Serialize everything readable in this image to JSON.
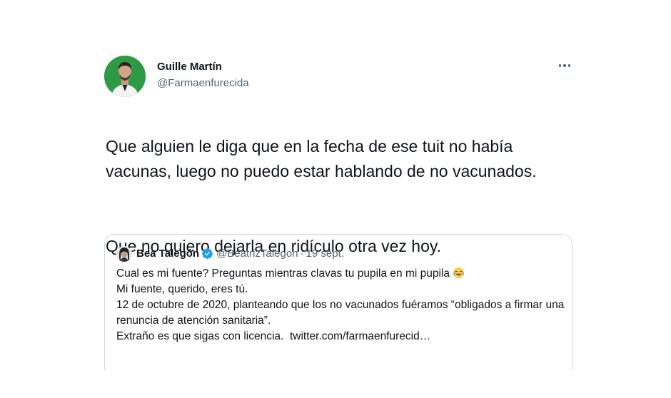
{
  "tweet": {
    "author_name": "Guille Martín",
    "author_handle": "@Farmaenfurecida",
    "paragraphs": [
      "Que alguien le diga que en la fecha de ese tuit no había vacunas, luego no puedo estar hablando de no vacunados.",
      "Que no quiero dejarla en ridículo otra vez hoy."
    ]
  },
  "quoted_tweet": {
    "author_name": "Bea Talegón",
    "author_handle": "@BeatrizTalegon",
    "separator": "·",
    "date": "19 sept.",
    "lines": [
      "Cual es mi fuente? Preguntas mientras clavas tu pupila en mi pupila",
      "Mi fuente, querido, eres tú.",
      "12 de octubre de 2020, planteando que los no vacunados fuéramos “obligados a firmar una renuncia de atención sanitaria”."
    ],
    "last_line_text": "Extraño es que sigas con licencia.",
    "link": "twitter.com/farmaenfurecid…"
  },
  "colors": {
    "text": "#0f1419",
    "secondary": "#536471",
    "border": "#cfd9de",
    "verified": "#1d9bf0",
    "avatar_bg": "#2f9a45"
  },
  "icons": {
    "more": "more-horizontal-icon",
    "verified": "verified-badge-icon",
    "emoji": "laughing-emoji-icon"
  }
}
